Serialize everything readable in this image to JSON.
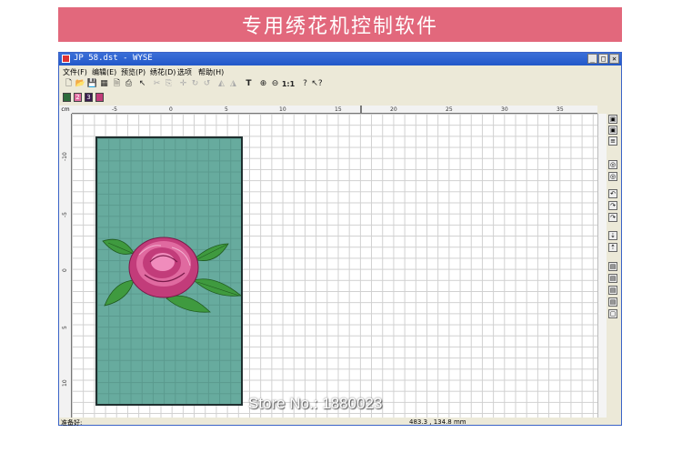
{
  "banner": {
    "title": "专用绣花机控制软件"
  },
  "window": {
    "title": "JP 58.dst - WYSE"
  },
  "menu": [
    "文件(F)",
    "编辑(E)",
    "预览(P)",
    "绣花(D)",
    "选项",
    "帮助(H)"
  ],
  "toolbar": {
    "icons": [
      "new-file-icon",
      "open-folder-icon",
      "save-icon",
      "save-all-icon",
      "preview-icon",
      "print-icon",
      "pointer-icon",
      "cut-icon",
      "copy-icon",
      "move-icon",
      "rotate-cw-icon",
      "rotate-ccw-icon",
      "mirror-h-icon",
      "mirror-v-icon",
      "text-icon",
      "zoom-in-icon",
      "zoom-out-icon",
      "zoom-1to1-icon",
      "help-icon",
      "context-help-icon"
    ],
    "zoom_label": "1:1",
    "text_tool": "T"
  },
  "colors": {
    "swatches": [
      {
        "label": "",
        "color": "#2d6b3a"
      },
      {
        "label": "2",
        "color": "#e06aa0"
      },
      {
        "label": "3",
        "color": "#3a1c4d"
      },
      {
        "label": "",
        "color": "#c23c7a"
      }
    ]
  },
  "ruler": {
    "unit": "cm",
    "h_ticks": [
      "-5",
      "0",
      "5",
      "10",
      "15",
      "20",
      "25",
      "30",
      "35"
    ],
    "v_ticks": [
      "-10",
      "-5",
      "0",
      "5",
      "10"
    ]
  },
  "status": {
    "left": "准备好:",
    "right": "483.3 , 134.8 mm"
  },
  "watermark": "Store No.: 1880023"
}
